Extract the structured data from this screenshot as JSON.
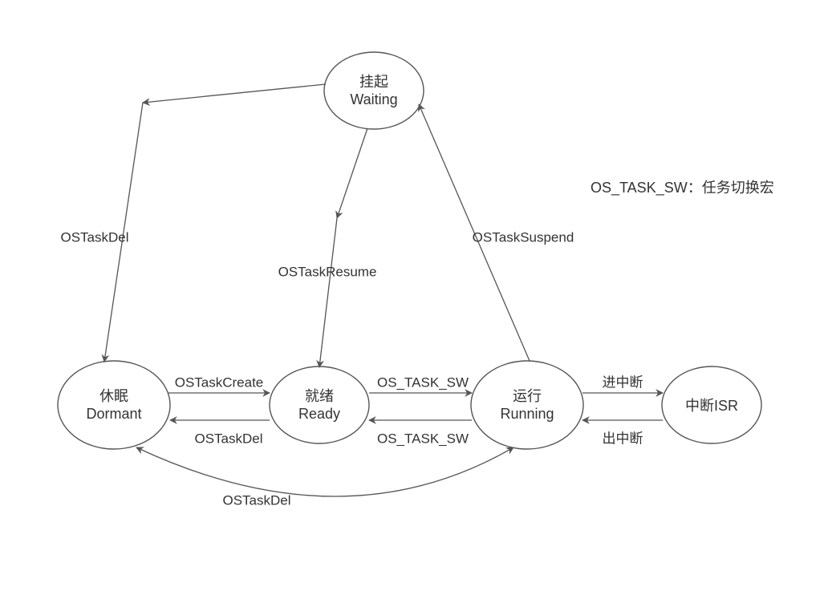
{
  "chart_data": {
    "type": "state_diagram",
    "nodes": [
      {
        "id": "waiting",
        "label_cn": "挂起",
        "label_en": "Waiting"
      },
      {
        "id": "dormant",
        "label_cn": "休眠",
        "label_en": "Dormant"
      },
      {
        "id": "ready",
        "label_cn": "就绪",
        "label_en": "Ready"
      },
      {
        "id": "running",
        "label_cn": "运行",
        "label_en": "Running"
      },
      {
        "id": "isr",
        "label_cn": "中断ISR",
        "label_en": ""
      }
    ],
    "edges": [
      {
        "from": "waiting",
        "to": "dormant",
        "label": "OSTaskDel"
      },
      {
        "from": "waiting",
        "to": "ready",
        "label": "OSTaskResume"
      },
      {
        "from": "running",
        "to": "waiting",
        "label": "OSTaskSuspend"
      },
      {
        "from": "dormant",
        "to": "ready",
        "label": "OSTaskCreate"
      },
      {
        "from": "ready",
        "to": "dormant",
        "label": "OSTaskDel"
      },
      {
        "from": "ready",
        "to": "running",
        "label": "OS_TASK_SW"
      },
      {
        "from": "running",
        "to": "ready",
        "label": "OS_TASK_SW"
      },
      {
        "from": "running",
        "to": "dormant",
        "label": "OSTaskDel"
      },
      {
        "from": "running",
        "to": "isr",
        "label": "进中断"
      },
      {
        "from": "isr",
        "to": "running",
        "label": "出中断"
      }
    ],
    "note": "OS_TASK_SW：任务切换宏"
  }
}
